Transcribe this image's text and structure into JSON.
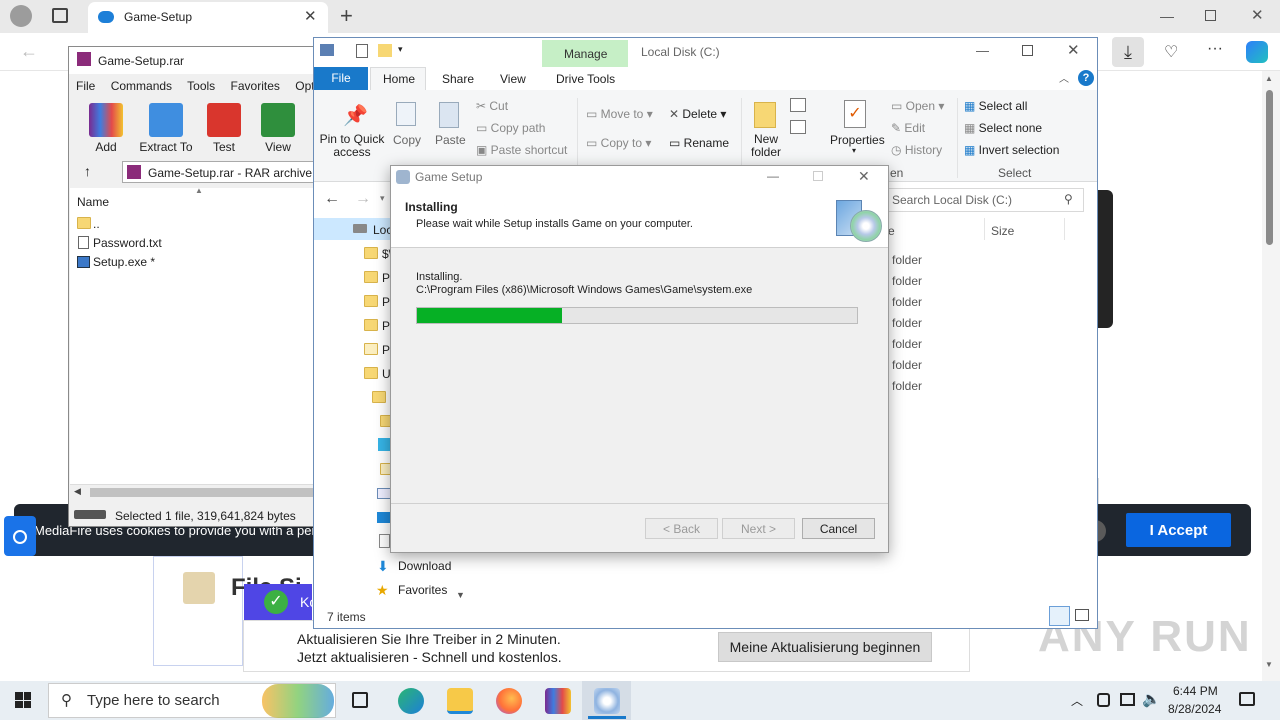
{
  "browser": {
    "tab_title": "Game-Setup",
    "cookie_text": "MediaFire uses cookies to provide you with a personalized experience",
    "accept_label": "I Accept",
    "file_heading": "File Si",
    "ad_check_text": "Ko",
    "ad_line1": "Aktualisieren Sie Ihre Treiber in 2 Minuten.",
    "ad_line2": "Jetzt aktualisieren - Schnell und kostenlos.",
    "ad_button": "Meine Aktualisierung beginnen",
    "watermark": "ANY RUN",
    "accent_color": "#0a66e0"
  },
  "winrar": {
    "title": "Game-Setup.rar",
    "menu": [
      "File",
      "Commands",
      "Tools",
      "Favorites",
      "Optio"
    ],
    "tools": [
      "Add",
      "Extract To",
      "Test",
      "View"
    ],
    "path": "Game-Setup.rar - RAR archive, u",
    "col_name": "Name",
    "files": [
      "..",
      "Password.txt",
      "Setup.exe *"
    ],
    "status": "Selected 1 file, 319,641,824 bytes"
  },
  "explorer": {
    "manage_label": "Manage",
    "title": "Local Disk (C:)",
    "tabs": [
      "File",
      "Home",
      "Share",
      "View",
      "Drive Tools"
    ],
    "ribbon": {
      "pin": "Pin to Quick access",
      "copy": "Copy",
      "paste": "Paste",
      "cut": "Cut",
      "copy_path": "Copy path",
      "paste_shortcut": "Paste shortcut",
      "move_to": "Move to",
      "copy_to": "Copy to",
      "delete": "Delete",
      "rename": "Rename",
      "new_folder": "New folder",
      "properties": "Properties",
      "open": "Open",
      "edit": "Edit",
      "history": "History",
      "open_group": "en",
      "select_all": "Select all",
      "select_none": "Select none",
      "invert_selection": "Invert selection",
      "select_group": "Select"
    },
    "search_placeholder": "Search Local Disk (C:)",
    "col_type": "e",
    "col_size": "Size",
    "tree_first": "Loc",
    "tree_letters": [
      "$\\",
      "P",
      "P",
      "Pr",
      "Pr",
      "U"
    ],
    "tree_download": "Download",
    "tree_favorites": "Favorites",
    "type_values": [
      "folder",
      "folder",
      "folder",
      "folder",
      "folder",
      "folder",
      "folder"
    ],
    "item_count": "7 items"
  },
  "setup": {
    "title": "Game Setup",
    "heading": "Installing",
    "subheading": "Please wait while Setup installs Game on your computer.",
    "status": "Installing.",
    "path": "C:\\Program Files (x86)\\Microsoft Windows Games\\Game\\system.exe",
    "progress": 0.33,
    "progress_color": "#06b025",
    "back_label": "< Back",
    "next_label": "Next >",
    "cancel_label": "Cancel"
  },
  "taskbar": {
    "search_placeholder": "Type here to search",
    "time": "6:44 PM",
    "date": "8/28/2024"
  }
}
